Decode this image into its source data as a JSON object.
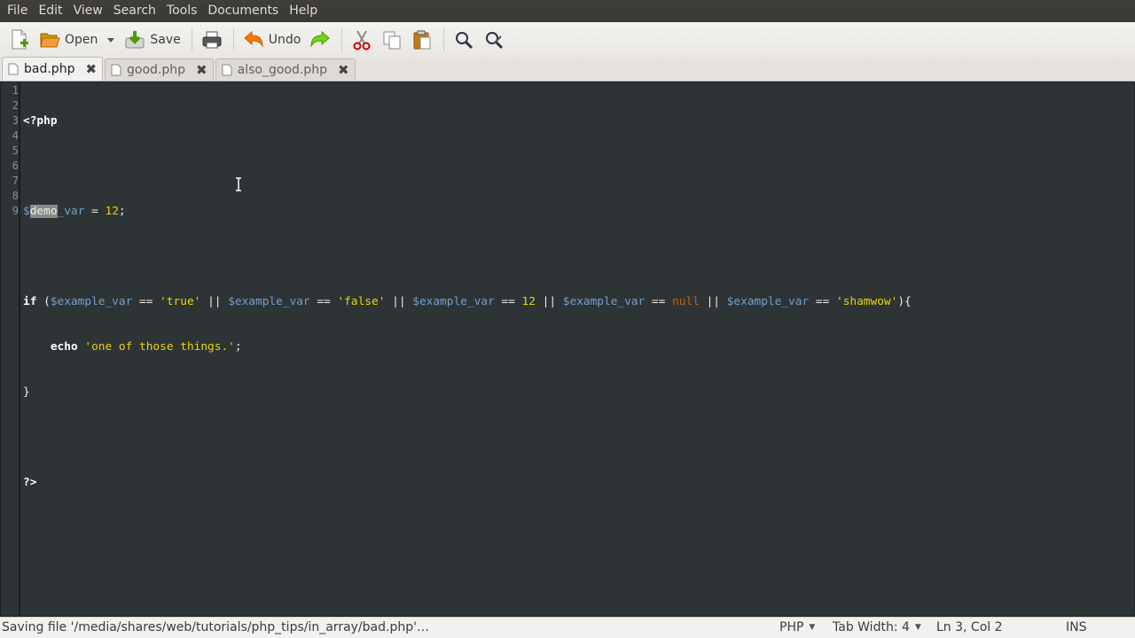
{
  "menu": [
    "File",
    "Edit",
    "View",
    "Search",
    "Tools",
    "Documents",
    "Help"
  ],
  "toolbar": {
    "new_icon": "new-document-icon",
    "open_label": "Open",
    "save_label": "Save",
    "print_icon": "print-icon",
    "undo_label": "Undo",
    "redo_icon": "redo-icon",
    "cut_icon": "cut-icon",
    "copy_icon": "copy-icon",
    "paste_icon": "paste-icon",
    "find_icon": "search-icon",
    "replace_icon": "search-replace-icon"
  },
  "tabs": [
    {
      "label": "bad.php",
      "active": true
    },
    {
      "label": "good.php",
      "active": false
    },
    {
      "label": "also_good.php",
      "active": false
    }
  ],
  "editor": {
    "line_numbers": [
      "1",
      "2",
      "3",
      "4",
      "5",
      "6",
      "7",
      "8",
      "9"
    ],
    "selected_text": "demo"
  },
  "status": {
    "message": "Saving file '/media/shares/web/tutorials/php_tips/in_array/bad.php'…",
    "language": "PHP",
    "tab_width": "Tab Width: 4",
    "position": "Ln 3, Col 2",
    "mode": "INS"
  },
  "colors": {
    "editor_bg": "#2e3436",
    "variable": "#729fcf",
    "string": "#edd400",
    "null": "#ce5c00",
    "menubar_bg": "#3c3b37"
  }
}
